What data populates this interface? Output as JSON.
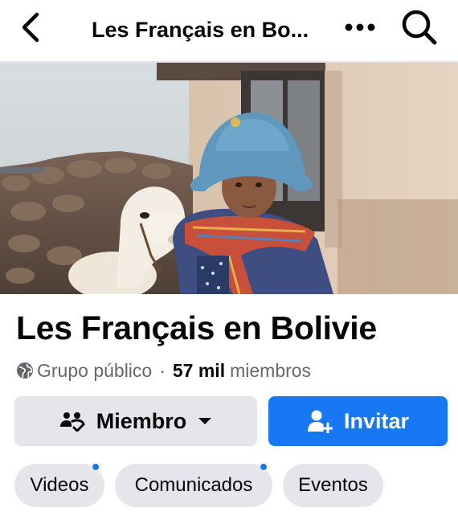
{
  "header": {
    "title": "Les Français en Bo...",
    "back_icon": "chevron-left-icon",
    "more_icon": "more-horizontal-icon",
    "search_icon": "search-icon"
  },
  "cover": {
    "icon": "cover-photo"
  },
  "group": {
    "name": "Les Français en Bolivie",
    "privacy": "Grupo público",
    "separator": "·",
    "member_count": "57 mil",
    "members_label": "miembros"
  },
  "actions": {
    "member_label": "Miembro",
    "invite_label": "Invitar"
  },
  "chips": [
    {
      "label": "Videos",
      "has_badge": true
    },
    {
      "label": "Comunicados",
      "has_badge": true
    },
    {
      "label": "Eventos",
      "has_badge": false
    }
  ],
  "colors": {
    "accent": "#1877f2",
    "button_gray": "#e4e6eb",
    "secondary_text": "#65676b"
  }
}
